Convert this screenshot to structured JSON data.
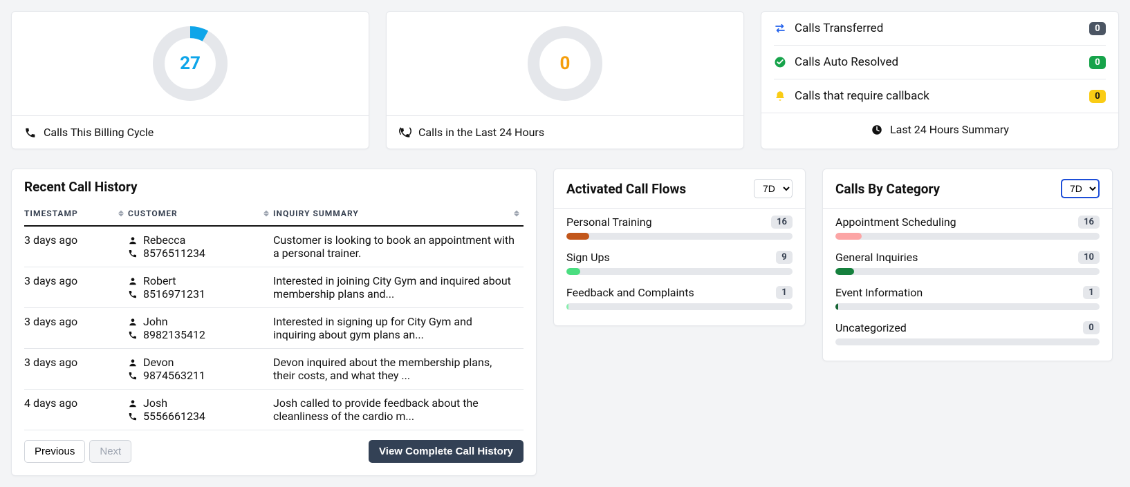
{
  "top": {
    "billing": {
      "value": "27",
      "label": "Calls This Billing Cycle",
      "color": "#0ea5e9",
      "percent": 8
    },
    "last24": {
      "value": "0",
      "label": "Calls in the Last 24 Hours",
      "color": "#f59e0b",
      "percent": 0
    }
  },
  "summary": {
    "title": "Last 24 Hours Summary",
    "items": [
      {
        "icon": "transfer",
        "label": "Calls Transferred",
        "count": "0",
        "badge": "dark"
      },
      {
        "icon": "check",
        "label": "Calls Auto Resolved",
        "count": "0",
        "badge": "green"
      },
      {
        "icon": "bell",
        "label": "Calls that require callback",
        "count": "0",
        "badge": "yellow"
      }
    ]
  },
  "history": {
    "title": "Recent Call History",
    "headers": {
      "timestamp": "TIMESTAMP",
      "customer": "CUSTOMER",
      "summary": "INQUIRY SUMMARY"
    },
    "rows": [
      {
        "ts": "3 days ago",
        "name": "Rebecca",
        "phone": "8576511234",
        "summary": "Customer is looking to book an appointment with a personal trainer."
      },
      {
        "ts": "3 days ago",
        "name": "Robert",
        "phone": "8516971231",
        "summary": "Interested in joining City Gym and inquired about membership plans and..."
      },
      {
        "ts": "3 days ago",
        "name": "John",
        "phone": "8982135412",
        "summary": "Interested in signing up for City Gym and inquiring about gym plans an..."
      },
      {
        "ts": "3 days ago",
        "name": "Devon",
        "phone": "9874563211",
        "summary": "Devon inquired about the membership plans, their costs, and what they ..."
      },
      {
        "ts": "4 days ago",
        "name": "Josh",
        "phone": "5556661234",
        "summary": "Josh called to provide feedback about the cleanliness of the cardio m..."
      }
    ],
    "prev": "Previous",
    "next": "Next",
    "viewAll": "View Complete Call History"
  },
  "flows": {
    "title": "Activated Call Flows",
    "range": "7D",
    "items": [
      {
        "label": "Personal Training",
        "count": "16",
        "color": "#c2561a",
        "pct": 10
      },
      {
        "label": "Sign Ups",
        "count": "9",
        "color": "#4ade80",
        "pct": 6
      },
      {
        "label": "Feedback and Complaints",
        "count": "1",
        "color": "#86efac",
        "pct": 1
      }
    ]
  },
  "categories": {
    "title": "Calls By Category",
    "range": "7D",
    "items": [
      {
        "label": "Appointment Scheduling",
        "count": "16",
        "color": "#fca5a5",
        "pct": 10
      },
      {
        "label": "General Inquiries",
        "count": "10",
        "color": "#15803d",
        "pct": 7
      },
      {
        "label": "Event Information",
        "count": "1",
        "color": "#166534",
        "pct": 1
      },
      {
        "label": "Uncategorized",
        "count": "0",
        "color": "#9ca3af",
        "pct": 0
      }
    ]
  }
}
